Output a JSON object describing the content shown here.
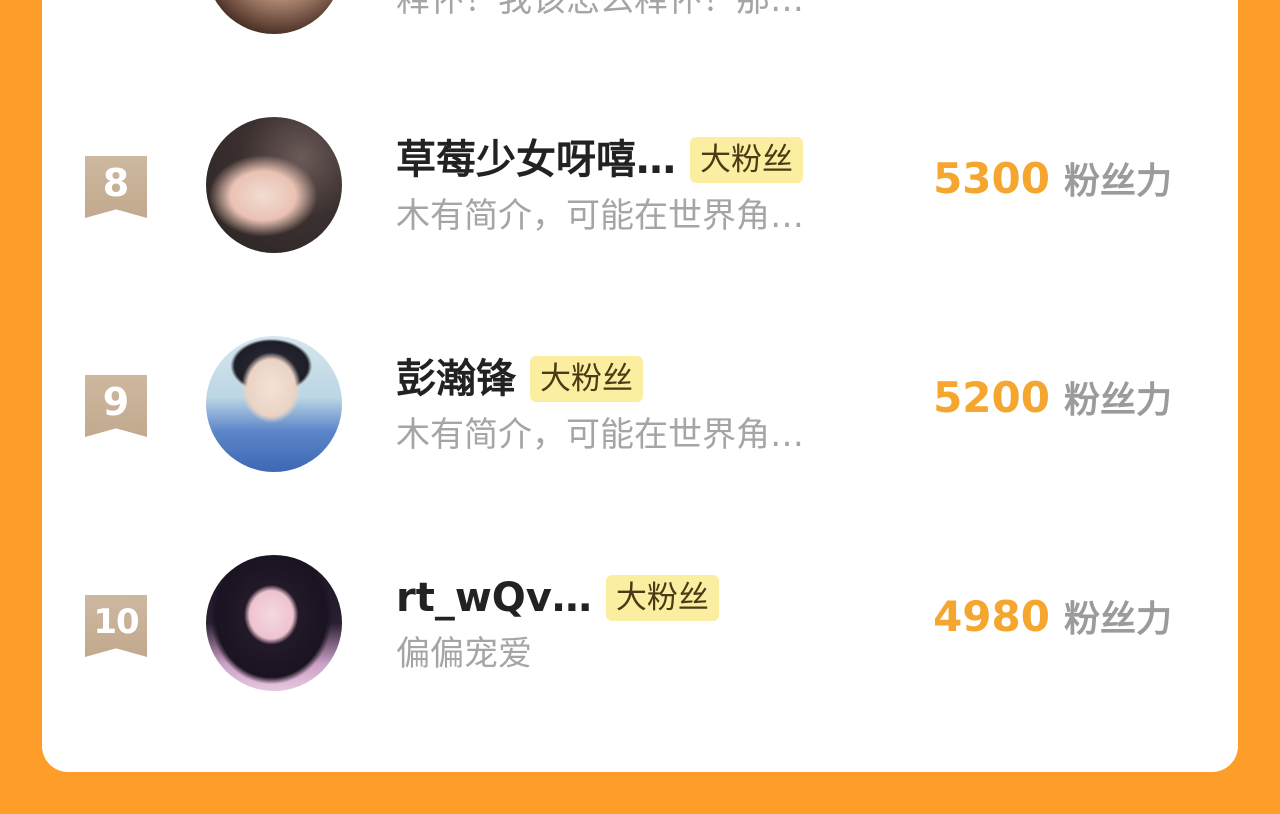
{
  "colors": {
    "background": "#FF9D2A",
    "card": "#FFFFFF",
    "rank_badge": "#C8B098",
    "fan_badge": "#FCEEA0",
    "stat_value": "#F4A62E",
    "secondary_text": "#A5A5A5"
  },
  "partial_row": {
    "bio": "释怀！我该怎么释怀！那…"
  },
  "rows": [
    {
      "rank": "8",
      "name": "草莓少女呀嘻…",
      "badge": "大粉丝",
      "bio": "木有简介，可能在世界角…",
      "value": "5300",
      "value_label": "粉丝力"
    },
    {
      "rank": "9",
      "name": "彭瀚锋",
      "badge": "大粉丝",
      "bio": "木有简介，可能在世界角…",
      "value": "5200",
      "value_label": "粉丝力"
    },
    {
      "rank": "10",
      "name": "rt_wQv…",
      "badge": "大粉丝",
      "bio": "偏偏宠爱",
      "value": "4980",
      "value_label": "粉丝力"
    }
  ]
}
